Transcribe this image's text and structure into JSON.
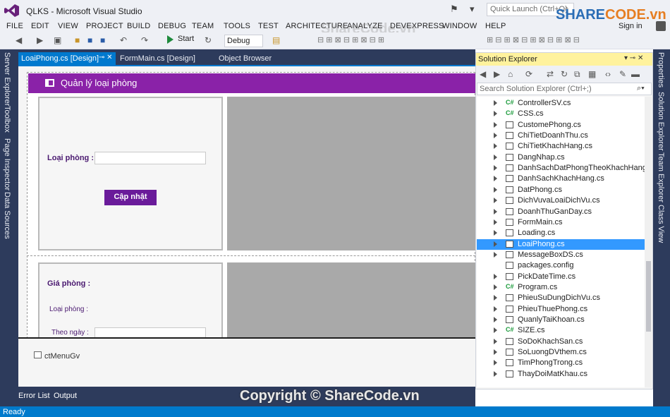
{
  "window": {
    "title": "QLKS - Microsoft Visual Studio",
    "quick_launch_placeholder": "Quick Launch (Ctrl+Q)",
    "sign_in": "Sign in"
  },
  "menu": [
    "FILE",
    "EDIT",
    "VIEW",
    "PROJECT",
    "BUILD",
    "DEBUG",
    "TEAM",
    "TOOLS",
    "TEST",
    "ARCHITECTURE",
    "ANALYZE",
    "DEVEXPRESS",
    "WINDOW",
    "HELP"
  ],
  "toolbar": {
    "start_label": "Start",
    "config": "Debug"
  },
  "left_rail": [
    "Server Explorer",
    "Toolbox",
    "Page Inspector",
    "Data Sources"
  ],
  "right_rail": [
    "Properties",
    "Solution Explorer",
    "Team Explorer",
    "Class View"
  ],
  "doc_tabs": [
    {
      "label": "LoaiPhong.cs [Design]",
      "active": true
    },
    {
      "label": "FormMain.cs [Design]",
      "active": false
    },
    {
      "label": "Object Browser",
      "active": false
    }
  ],
  "form": {
    "title": "Quản lý loại phòng",
    "loai_phong_label": "Loại phòng :",
    "update_button": "Cập nhật",
    "gia_phong_label": "Giá phòng :",
    "loai_phong_sub_label": "Loại phòng :",
    "theo_ngay_label": "Theo ngày :",
    "tray_component": "ctMenuGv"
  },
  "solution_explorer": {
    "title": "Solution Explorer",
    "search_placeholder": "Search Solution Explorer (Ctrl+;)",
    "items": [
      {
        "name": "ControllerSV.cs",
        "kind": "class"
      },
      {
        "name": "CSS.cs",
        "kind": "class"
      },
      {
        "name": "CustomePhong.cs",
        "kind": "control"
      },
      {
        "name": "ChiTietDoanhThu.cs",
        "kind": "form"
      },
      {
        "name": "ChiTietKhachHang.cs",
        "kind": "form"
      },
      {
        "name": "DangNhap.cs",
        "kind": "form"
      },
      {
        "name": "DanhSachDatPhongTheoKhachHang.cs",
        "kind": "form"
      },
      {
        "name": "DanhSachKhachHang.cs",
        "kind": "form"
      },
      {
        "name": "DatPhong.cs",
        "kind": "form"
      },
      {
        "name": "DichVuvaLoaiDichVu.cs",
        "kind": "form"
      },
      {
        "name": "DoanhThuGanDay.cs",
        "kind": "form"
      },
      {
        "name": "FormMain.cs",
        "kind": "form"
      },
      {
        "name": "Loading.cs",
        "kind": "form"
      },
      {
        "name": "LoaiPhong.cs",
        "kind": "form",
        "selected": true
      },
      {
        "name": "MessageBoxDS.cs",
        "kind": "form"
      },
      {
        "name": "packages.config",
        "kind": "config"
      },
      {
        "name": "PickDateTime.cs",
        "kind": "form"
      },
      {
        "name": "Program.cs",
        "kind": "class"
      },
      {
        "name": "PhieuSuDungDichVu.cs",
        "kind": "form"
      },
      {
        "name": "PhieuThuePhong.cs",
        "kind": "form"
      },
      {
        "name": "QuanlyTaiKhoan.cs",
        "kind": "form"
      },
      {
        "name": "SIZE.cs",
        "kind": "class"
      },
      {
        "name": "SoDoKhachSan.cs",
        "kind": "form"
      },
      {
        "name": "SoLuongDVthem.cs",
        "kind": "form"
      },
      {
        "name": "TimPhongTrong.cs",
        "kind": "form"
      },
      {
        "name": "ThayDoiMatKhau.cs",
        "kind": "form"
      }
    ]
  },
  "bottom_tabs": [
    "Error List",
    "Output"
  ],
  "status": "Ready",
  "watermark": {
    "logo_a": "SHARE",
    "logo_b": "CODE.vn",
    "top": "ShareCode.vn",
    "bottom": "Copyright © ShareCode.vn"
  }
}
